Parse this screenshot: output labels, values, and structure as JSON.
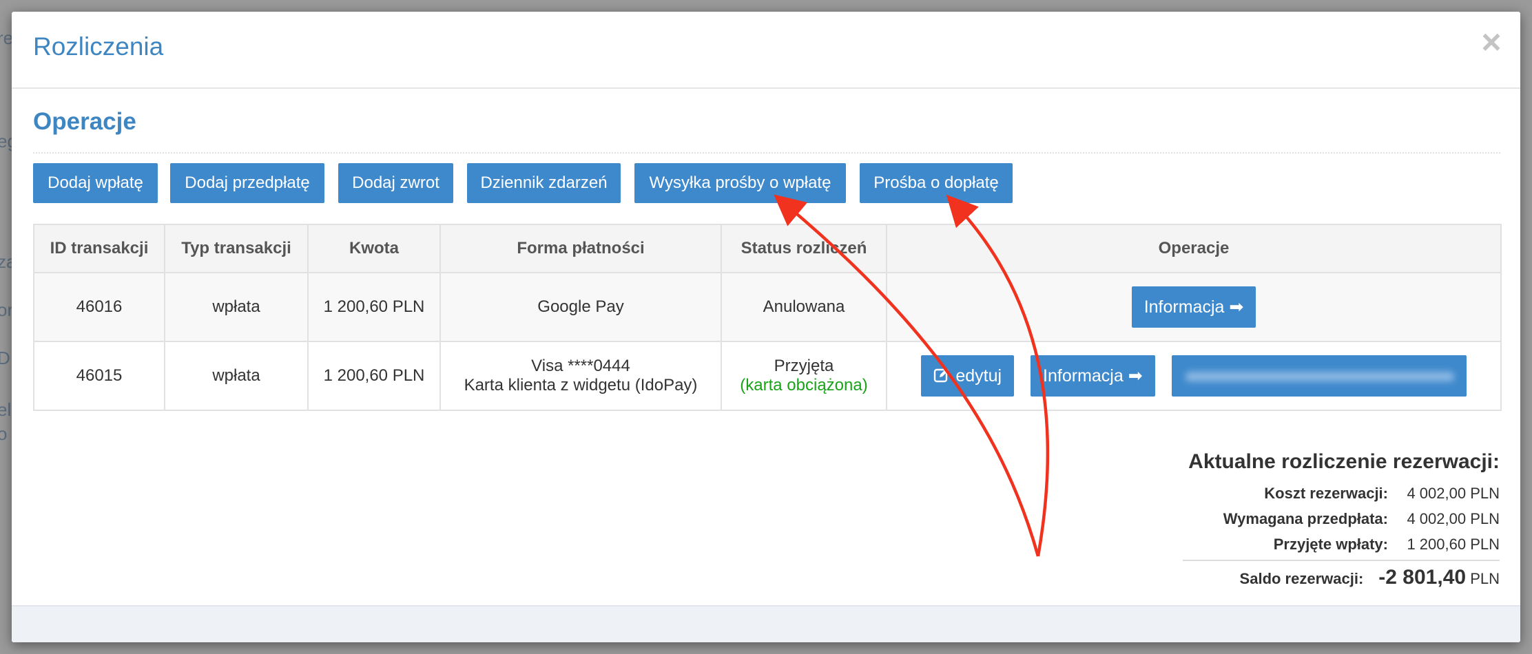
{
  "modal": {
    "title": "Rozliczenia",
    "close_label": "×"
  },
  "operations": {
    "section_title": "Operacje",
    "buttons": [
      {
        "label": "Dodaj wpłatę"
      },
      {
        "label": "Dodaj przedpłatę"
      },
      {
        "label": "Dodaj zwrot"
      },
      {
        "label": "Dziennik zdarzeń"
      },
      {
        "label": "Wysyłka prośby o wpłatę"
      },
      {
        "label": "Prośba o dopłatę"
      }
    ]
  },
  "table": {
    "headers": [
      "ID transakcji",
      "Typ transakcji",
      "Kwota",
      "Forma płatności",
      "Status rozliczeń",
      "Operacje"
    ],
    "rows": [
      {
        "id": "46016",
        "type": "wpłata",
        "amount": "1 200,60 PLN",
        "method_line1": "Google Pay",
        "status": "Anulowana",
        "info_label": "Informacja ➡"
      },
      {
        "id": "46015",
        "type": "wpłata",
        "amount": "1 200,60 PLN",
        "method_line1": "Visa ****0444",
        "method_line2": "Karta klienta z widgetu (IdoPay)",
        "status": "Przyjęta",
        "status_sub": "(karta obciążona)",
        "edit_label": "edytuj",
        "info_label": "Informacja ➡"
      }
    ]
  },
  "summary": {
    "title": "Aktualne rozliczenie rezerwacji:",
    "rows": [
      {
        "label": "Koszt rezerwacji:",
        "value": "4 002,00 PLN"
      },
      {
        "label": "Wymagana przedpłata:",
        "value": "4 002,00 PLN"
      },
      {
        "label": "Przyjęte wpłaty:",
        "value": "1 200,60 PLN"
      }
    ],
    "saldo_label": "Saldo rezerwacji:",
    "saldo_value": "-2 801,40",
    "saldo_unit": "PLN"
  },
  "colors": {
    "accent": "#3e89cc",
    "title_blue": "#3e86c1",
    "success_green": "#18a318",
    "annotation_red": "#f0321e"
  },
  "icons": {
    "edit": "pencil-square-icon",
    "arrow": "arrow-right-icon",
    "close": "close-icon"
  }
}
